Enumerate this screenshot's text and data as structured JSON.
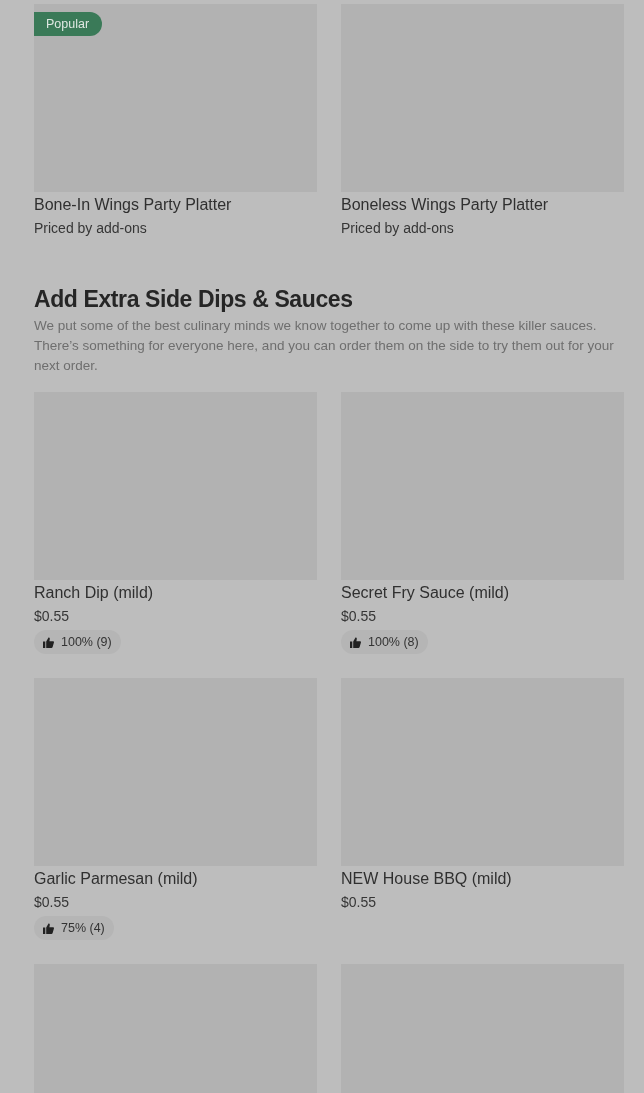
{
  "sections": [
    {
      "items": [
        {
          "kind": "dish",
          "badge": "Popular",
          "name": "Bone-In Wings Party Platter",
          "price": "Priced by add-ons"
        },
        {
          "kind": "dish",
          "name": "Boneless Wings Party Platter",
          "price": "Priced by add-ons"
        }
      ]
    },
    {
      "title": "Add Extra Side Dips & Sauces",
      "description": "We put some of the best culinary minds we know together to come up with these killer sauces. There’s something for everyone here, and you can order them on the side to try them out for your next order.",
      "items": [
        {
          "kind": "dish",
          "name": "Ranch Dip (mild)",
          "price": "$0.55",
          "rating": "100% (9)"
        },
        {
          "kind": "dish",
          "name": "Secret Fry Sauce (mild)",
          "price": "$0.55",
          "rating": "100% (8)"
        },
        {
          "kind": "dish",
          "name": "Garlic Parmesan (mild)",
          "price": "$0.55",
          "rating": "75% (4)"
        },
        {
          "kind": "dish",
          "name": "NEW House BBQ (mild)",
          "price": "$0.55"
        },
        {
          "kind": "picture"
        },
        {
          "kind": "picture"
        }
      ]
    }
  ]
}
